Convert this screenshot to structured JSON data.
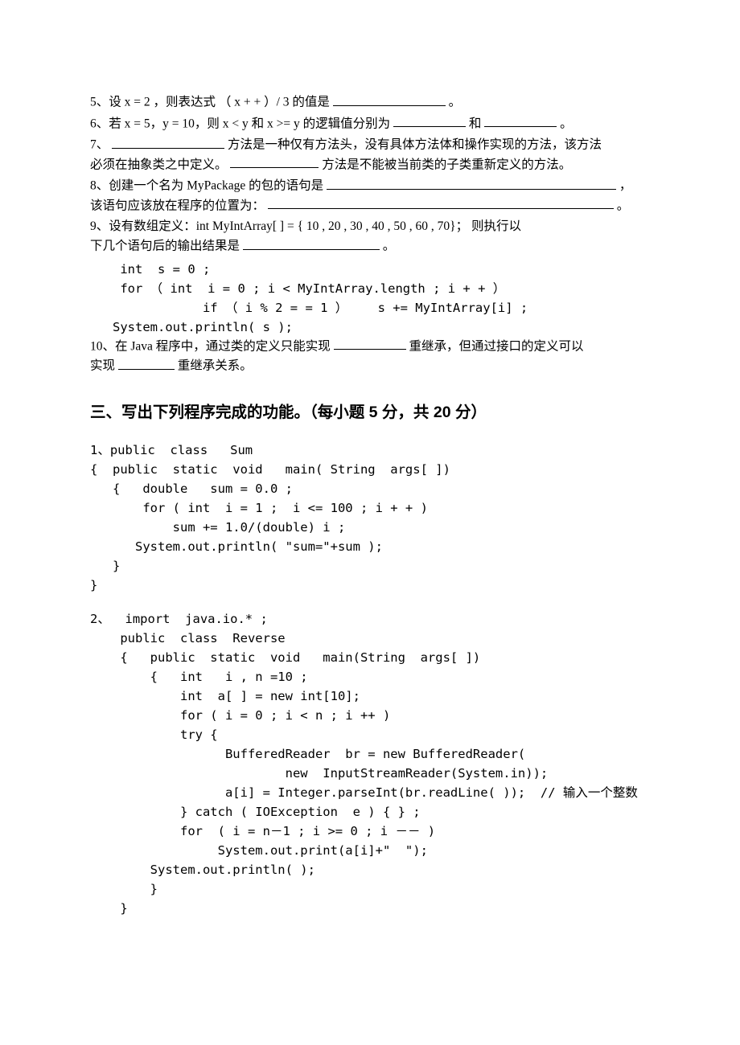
{
  "q5": {
    "prefix": "5、设 x = 2 ，则表达式 （ x + + ）/ 3 的值是",
    "suffix": " 。"
  },
  "q6": {
    "prefix": "6、若 x = 5，y = 10，则 x < y 和 x >= y 的逻辑值分别为",
    "mid": "和 ",
    "suffix": " 。"
  },
  "q7": {
    "line1a": "7、",
    "line1b": " 方法是一种仅有方法头，没有具体方法体和操作实现的方法，该方法",
    "line2a": "必须在抽象类之中定义。",
    "line2b": "方法是不能被当前类的子类重新定义的方法。"
  },
  "q8": {
    "line1a": "8、创建一个名为 MyPackage 的包的语句是",
    "line1b": "，",
    "line2a": "该语句应该放在程序的位置为：",
    "line2b": "。"
  },
  "q9": {
    "line1": "9、设有数组定义：int   MyIntArray[ ] = { 10 , 20 , 30 , 40 , 50 , 60 , 70}；  则执行以",
    "line2a": "下几个语句后的输出结果是  ",
    "line2b": "。",
    "code": "    int  s = 0 ;\n    for （ int  i = 0 ; i < MyIntArray.length ; i + + ）\n               if （ i % 2 = = 1 ）    s += MyIntArray[i] ;\n   System.out.println( s );"
  },
  "q10": {
    "line1a": "10、在 Java 程序中，通过类的定义只能实现",
    "line1b": "重继承，但通过接口的定义可以",
    "line2a": "实现",
    "line2b": "重继承关系。"
  },
  "section3_title": "三、写出下列程序完成的功能。（每小题 5 分，共 20 分）",
  "prog1": "1、public  class   Sum\n{  public  static  void   main( String  args[ ])\n   {   double   sum = 0.0 ;\n       for ( int  i = 1 ;  i <= 100 ; i + + )\n           sum += 1.0/(double) i ;\n      System.out.println( \"sum=\"+sum );\n   }\n}",
  "prog2": "2、  import  java.io.* ;\n    public  class  Reverse\n    {   public  static  void   main(String  args[ ])\n        {   int   i , n =10 ;\n            int  a[ ] = new int[10];\n            for ( i = 0 ; i < n ; i ++ )\n            try {\n                  BufferedReader  br = new BufferedReader(\n                          new  InputStreamReader(System.in));\n                  a[i] = Integer.parseInt(br.readLine( ));  // 输入一个整数\n            } catch ( IOException  e ) { } ;\n            for  ( i = n－1 ; i >= 0 ; i －－ )\n                 System.out.print(a[i]+\"  \");\n        System.out.println( );\n        }\n    }"
}
